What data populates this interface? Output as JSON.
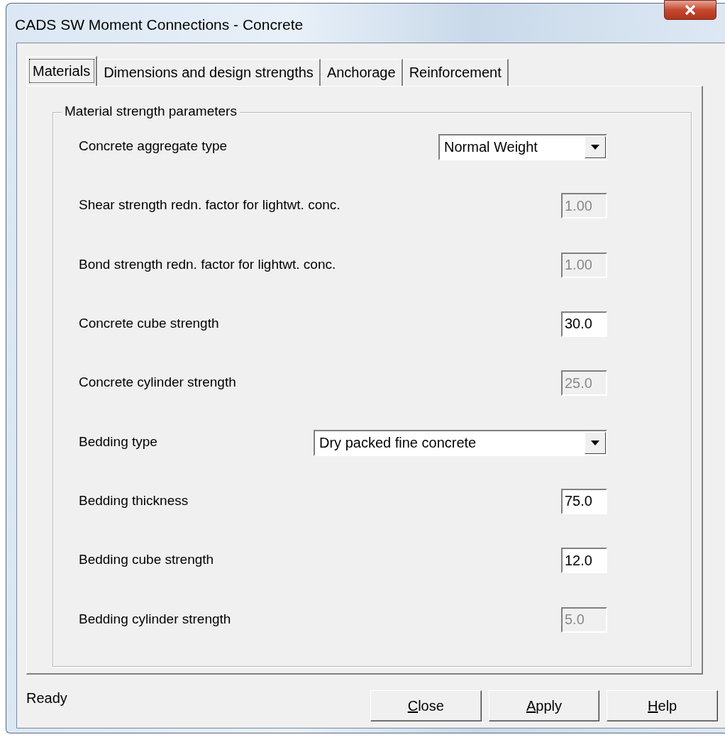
{
  "window": {
    "title": "CADS SW Moment Connections - Concrete"
  },
  "tabs": [
    {
      "label": "Materials",
      "selected": true
    },
    {
      "label": "Dimensions and design strengths",
      "selected": false
    },
    {
      "label": "Anchorage",
      "selected": false
    },
    {
      "label": "Reinforcement",
      "selected": false
    }
  ],
  "group": {
    "title": "Material strength parameters"
  },
  "fields": [
    {
      "kind": "dropdown",
      "label": "Concrete aggregate type",
      "value": "Normal Weight",
      "disabled": false
    },
    {
      "kind": "input",
      "label": "Shear strength redn. factor for lightwt. conc.",
      "value": "1.00",
      "disabled": true
    },
    {
      "kind": "input",
      "label": "Bond strength redn. factor for lightwt. conc.",
      "value": "1.00",
      "disabled": true
    },
    {
      "kind": "input",
      "label": "Concrete cube strength",
      "value": "30.0",
      "disabled": false
    },
    {
      "kind": "input",
      "label": "Concrete cylinder strength",
      "value": "25.0",
      "disabled": true
    },
    {
      "kind": "widedropdown",
      "label": "Bedding type",
      "value": "Dry packed fine concrete",
      "disabled": false
    },
    {
      "kind": "input",
      "label": "Bedding thickness",
      "value": "75.0",
      "disabled": false
    },
    {
      "kind": "input",
      "label": "Bedding cube strength",
      "value": "12.0",
      "disabled": false
    },
    {
      "kind": "input",
      "label": "Bedding cylinder strength",
      "value": "5.0",
      "disabled": true
    }
  ],
  "status_bar": {
    "text": "Ready"
  },
  "buttons": [
    {
      "label": "Close",
      "underline_first": true
    },
    {
      "label": "Apply",
      "underline_first": true
    },
    {
      "label": "Help",
      "underline_first": true
    }
  ]
}
